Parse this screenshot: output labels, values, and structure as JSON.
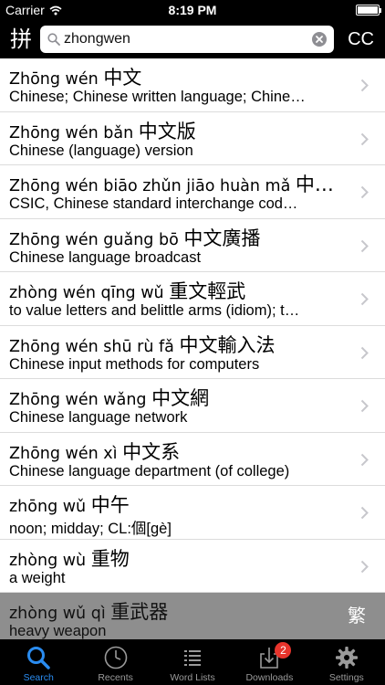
{
  "status_bar": {
    "carrier": "Carrier",
    "time": "8:19 PM",
    "battery_level": 1.0
  },
  "nav_bar": {
    "pinyin_toggle_label": "拼",
    "search_value": "zhongwen",
    "cc_label": "CC"
  },
  "results": [
    {
      "pinyin": "Zhōng wén",
      "hanzi": "中文",
      "definition": "Chinese; Chinese written language; Chine…"
    },
    {
      "pinyin": "Zhōng wén bǎn",
      "hanzi": "中文版",
      "definition": "Chinese (language) version"
    },
    {
      "pinyin": "Zhōng wén biāo zhǔn jiāo huàn mǎ",
      "hanzi": "中…",
      "definition": "CSIC, Chinese standard interchange cod…"
    },
    {
      "pinyin": "Zhōng wén guǎng bō",
      "hanzi": "中文廣播",
      "definition": "Chinese language broadcast"
    },
    {
      "pinyin": "zhòng wén qīng wǔ",
      "hanzi": "重文輕武",
      "definition": "to value letters and belittle arms (idiom); t…"
    },
    {
      "pinyin": "Zhōng wén shū rù fǎ",
      "hanzi": "中文輸入法",
      "definition": "Chinese input methods for computers"
    },
    {
      "pinyin": "Zhōng wén wǎng",
      "hanzi": "中文網",
      "definition": "Chinese language network"
    },
    {
      "pinyin": "Zhōng wén xì",
      "hanzi": "中文系",
      "definition": "Chinese language department (of college)"
    },
    {
      "pinyin": "zhōng wǔ",
      "hanzi": "中午",
      "definition": "noon; midday; CL:個[gè]"
    },
    {
      "pinyin": "zhòng wù",
      "hanzi": "重物",
      "definition": "a weight"
    },
    {
      "pinyin": "zhòng wǔ qì",
      "hanzi": "重武器",
      "definition": "heavy weapon"
    }
  ],
  "traditional_toggle_label": "繁",
  "tab_bar": {
    "tabs": [
      {
        "label": "Search",
        "icon": "search-icon",
        "active": true
      },
      {
        "label": "Recents",
        "icon": "clock-icon",
        "active": false
      },
      {
        "label": "Word Lists",
        "icon": "list-icon",
        "active": false
      },
      {
        "label": "Downloads",
        "icon": "download-icon",
        "active": false,
        "badge": "2"
      },
      {
        "label": "Settings",
        "icon": "gear-icon",
        "active": false
      }
    ]
  },
  "colors": {
    "accent": "#2a8cf0",
    "badge": "#e8342c",
    "bar_background": "#000000",
    "highlight_row": "#8e8e8e"
  }
}
